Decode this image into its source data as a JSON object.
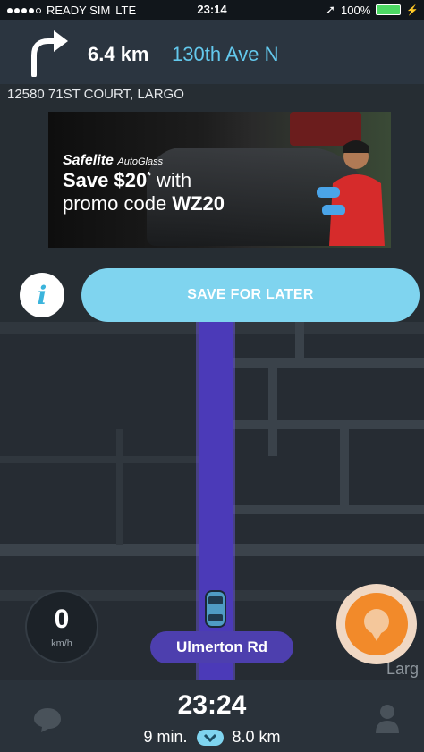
{
  "status": {
    "carrier": "READY SIM",
    "network": "LTE",
    "time": "23:14",
    "battery": "100%",
    "icons": [
      "signal-dots",
      "location-arrow-icon",
      "battery-icon",
      "charging-bolt-icon"
    ]
  },
  "nav": {
    "turn_direction": "turn-right-icon",
    "distance": "6.4 km",
    "street": "130th Ave N",
    "colors": {
      "street": "#63c8ec",
      "header_bg": "#2b3540"
    }
  },
  "destination": {
    "address": "12580 71ST COURT, LARGO"
  },
  "ad": {
    "brand": "Safelite",
    "brand_sub": "AutoGlass",
    "headline_1": "Save $20",
    "asterisk": "*",
    "headline_with": "with",
    "headline_2": "promo code",
    "promo_code": "WZ20"
  },
  "actions": {
    "info_label": "i",
    "save_label": "SAVE FOR LATER",
    "colors": {
      "save_button": "#7fd4ef"
    }
  },
  "map": {
    "road_label": "Ulmerton Rd",
    "city_label": "Larg",
    "speed_value": "0",
    "speed_unit": "km/h",
    "colors": {
      "route": "#4b3ab8",
      "report_button": "#f28a2a"
    }
  },
  "trip": {
    "eta": "23:24",
    "duration": "9 min.",
    "distance": "8.0 km",
    "icons": [
      "chat-bubble-icon",
      "route-chevron-icon",
      "user-profile-icon"
    ]
  }
}
